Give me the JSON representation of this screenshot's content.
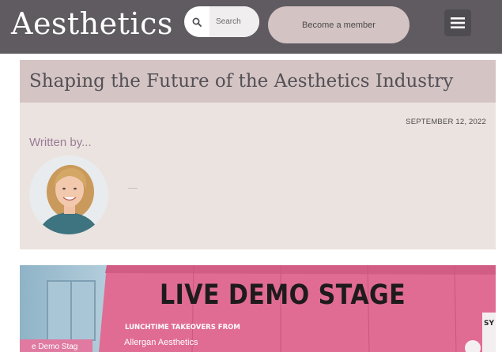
{
  "header": {
    "logo_text": "Aesthetics",
    "search": {
      "placeholder": "Search",
      "icon": "search-icon"
    },
    "member_button_label": "Become a member",
    "menu_icon": "hamburger-menu-icon",
    "background_color": "#5f5b61",
    "button_color": "#d3c3c2"
  },
  "article": {
    "title": "Shaping the Future of the Aesthetics Industry",
    "date": "SEPTEMBER 12, 2022",
    "written_by_label": "Written by...",
    "author_name": "——",
    "title_band_color": "#d4c4c3",
    "meta_panel_color": "#ebe3df"
  },
  "hero_image": {
    "stage_title": "LIVE DEMO STAGE",
    "subheading": "LUNCHTIME TAKEOVERS FROM",
    "brand": "Allergan Aesthetics",
    "side_sign": "e Demo Stag",
    "corner_text": "SY"
  }
}
